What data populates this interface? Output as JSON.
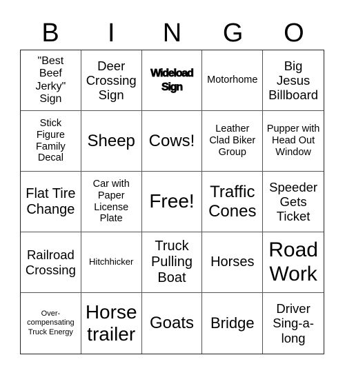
{
  "header": {
    "letters": [
      "B",
      "I",
      "N",
      "G",
      "O"
    ]
  },
  "cells": [
    {
      "text": "\"Best Beef Jerky\" Sign"
    },
    {
      "text": "Deer Crossing Sign"
    },
    {
      "text": "Wideload Sign"
    },
    {
      "text": "Motorhome"
    },
    {
      "text": "Big Jesus Billboard"
    },
    {
      "text": "Stick Figure Family Decal"
    },
    {
      "text": "Sheep"
    },
    {
      "text": "Cows!"
    },
    {
      "text": "Leather Clad Biker Group"
    },
    {
      "text": "Pupper with Head Out Window"
    },
    {
      "text": "Flat Tire Change"
    },
    {
      "text": "Car with Paper License Plate"
    },
    {
      "text": "Free!"
    },
    {
      "text": "Traffic Cones"
    },
    {
      "text": "Speeder Gets Ticket"
    },
    {
      "text": "Railroad Crossing"
    },
    {
      "text": "Hitchhicker"
    },
    {
      "text": "Truck Pulling Boat"
    },
    {
      "text": "Horses"
    },
    {
      "text": "Road Work"
    },
    {
      "text": "Over-compensating Truck Energy"
    },
    {
      "text": "Horse trailer"
    },
    {
      "text": "Goats"
    },
    {
      "text": "Bridge"
    },
    {
      "text": "Driver Sing-a-long"
    }
  ]
}
